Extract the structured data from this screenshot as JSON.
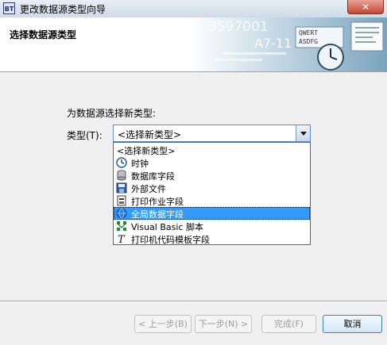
{
  "window": {
    "title": "更改数据源类型向导",
    "close_label": "✕",
    "icon_text": "BT"
  },
  "header": {
    "title": "选择数据源类型"
  },
  "banner": {
    "big_number": "3597001",
    "code": "A7-11",
    "keys_row1": "QWERT",
    "keys_row2": "ASDFG"
  },
  "main": {
    "prompt": "为数据源选择新类型:",
    "type_label": "类型(T):",
    "combo_value": "<选择新类型>"
  },
  "dropdown": {
    "items": [
      {
        "label": "<选择新类型>",
        "icon": "none"
      },
      {
        "label": "时钟",
        "icon": "clock-icon"
      },
      {
        "label": "数据库字段",
        "icon": "database-icon"
      },
      {
        "label": "外部文件",
        "icon": "floppy-disk-icon"
      },
      {
        "label": "打印作业字段",
        "icon": "print-job-icon"
      },
      {
        "label": "全局数据字段",
        "icon": "globe-icon"
      },
      {
        "label": "Visual Basic 脚本",
        "icon": "vb-script-icon"
      },
      {
        "label": "打印机代码模板字段",
        "icon": "font-template-icon"
      }
    ],
    "selected": "全局数据字段"
  },
  "buttons": {
    "back": "< 上一步(B)",
    "next": "下一步(N) >",
    "finish": "完成(F)",
    "cancel": "取消"
  },
  "colors": {
    "accent": "#3399ff",
    "header_bg": "#ffffff",
    "window_bg": "#f0f0f0"
  }
}
